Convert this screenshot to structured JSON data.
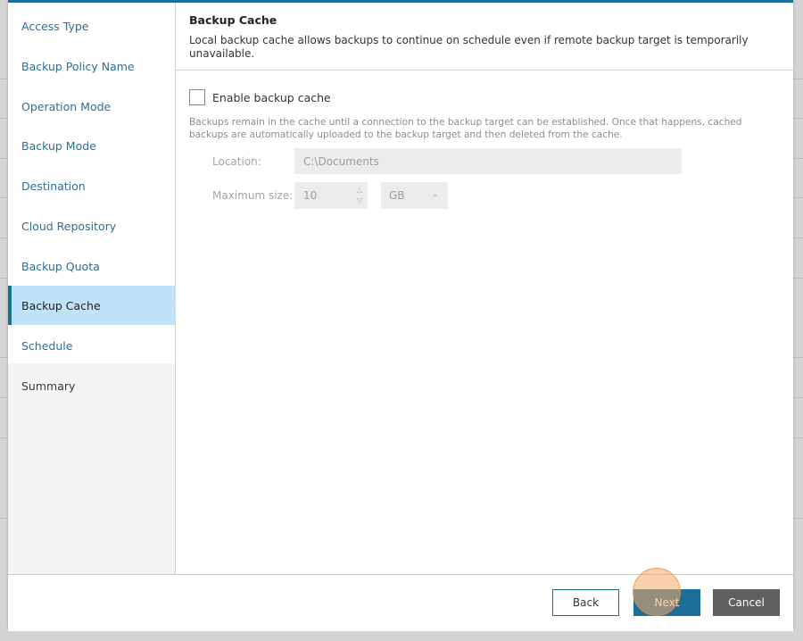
{
  "sidebar": {
    "items": [
      {
        "label": "Access Type"
      },
      {
        "label": "Backup Policy Name"
      },
      {
        "label": "Operation Mode"
      },
      {
        "label": "Backup Mode"
      },
      {
        "label": "Destination"
      },
      {
        "label": "Cloud Repository"
      },
      {
        "label": "Backup Quota"
      },
      {
        "label": "Backup Cache"
      },
      {
        "label": "Schedule"
      },
      {
        "label": "Summary"
      }
    ],
    "active_index": 7
  },
  "header": {
    "title": "Backup Cache",
    "description": "Local backup cache allows backups to continue on schedule even if remote backup target is temporarily unavailable."
  },
  "cache": {
    "enable_label": "Enable backup cache",
    "enabled": false,
    "description": "Backups remain in the cache until a connection to the backup target can be established. Once that happens, cached backups are automatically uploaded to the backup target and then deleted from the cache.",
    "location_label": "Location:",
    "location_value": "C:\\Documents",
    "max_size_label": "Maximum size:",
    "max_size_value": "10",
    "unit_value": "GB"
  },
  "footer": {
    "back_label": "Back",
    "next_label": "Next",
    "cancel_label": "Cancel"
  },
  "colors": {
    "accent": "#1b6f99",
    "active_bg": "#bfe3fa",
    "cancel_bg": "#5f5f5f"
  }
}
